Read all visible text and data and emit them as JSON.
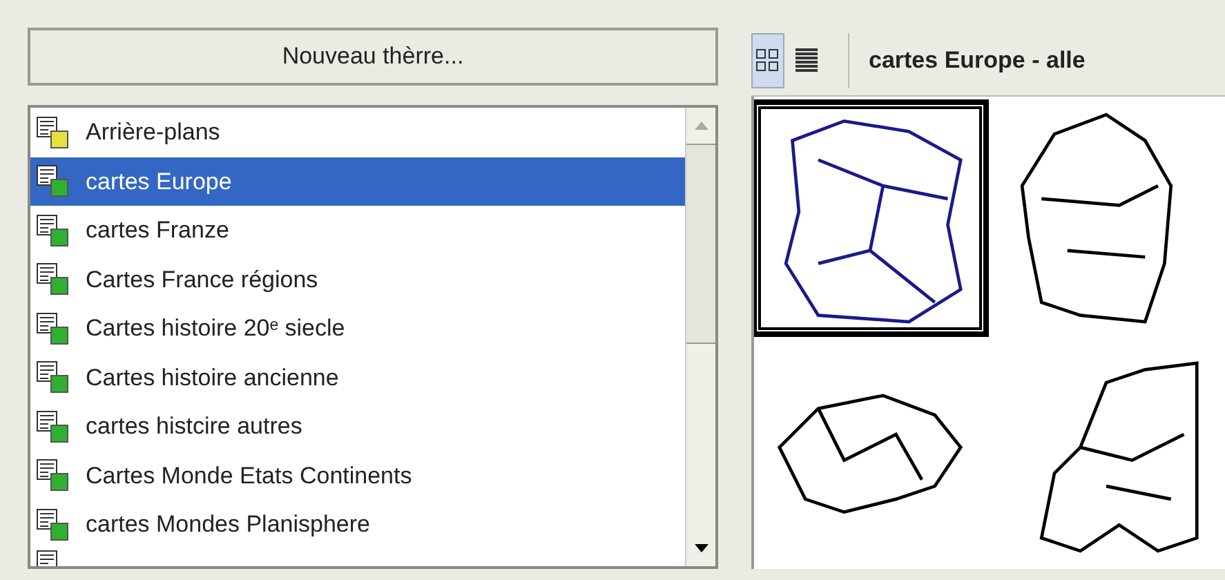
{
  "new_theme_button": "Nouveau thèrre...",
  "themes": [
    {
      "label": "Arrière-plans",
      "color": "#e8e040",
      "selected": false
    },
    {
      "label": "cartes Europe",
      "color": "#30b030",
      "selected": true
    },
    {
      "label": "cartes Franze",
      "color": "#30b030",
      "selected": false
    },
    {
      "label": "Cartes France régions",
      "color": "#30b030",
      "selected": false
    },
    {
      "label": "Cartes histoire 20ᵉ siecle",
      "color": "#30b030",
      "selected": false
    },
    {
      "label": "Cartes histoire ancienne",
      "color": "#30b030",
      "selected": false
    },
    {
      "label": "cartes histcire autres",
      "color": "#30b030",
      "selected": false
    },
    {
      "label": "Cartes Monde Etats Continents",
      "color": "#30b030",
      "selected": false
    },
    {
      "label": "cartes Mondes Planisphere",
      "color": "#30b030",
      "selected": false
    }
  ],
  "view_modes": [
    {
      "kind": "grid",
      "selected": true
    },
    {
      "kind": "list",
      "selected": false
    }
  ],
  "gallery_title": "cartes Europe - alle",
  "thumbnails": [
    {
      "kind": "regions",
      "selected": true
    },
    {
      "kind": "country",
      "selected": false
    },
    {
      "kind": "swiss",
      "selected": false
    },
    {
      "kind": "europe",
      "selected": false
    }
  ]
}
